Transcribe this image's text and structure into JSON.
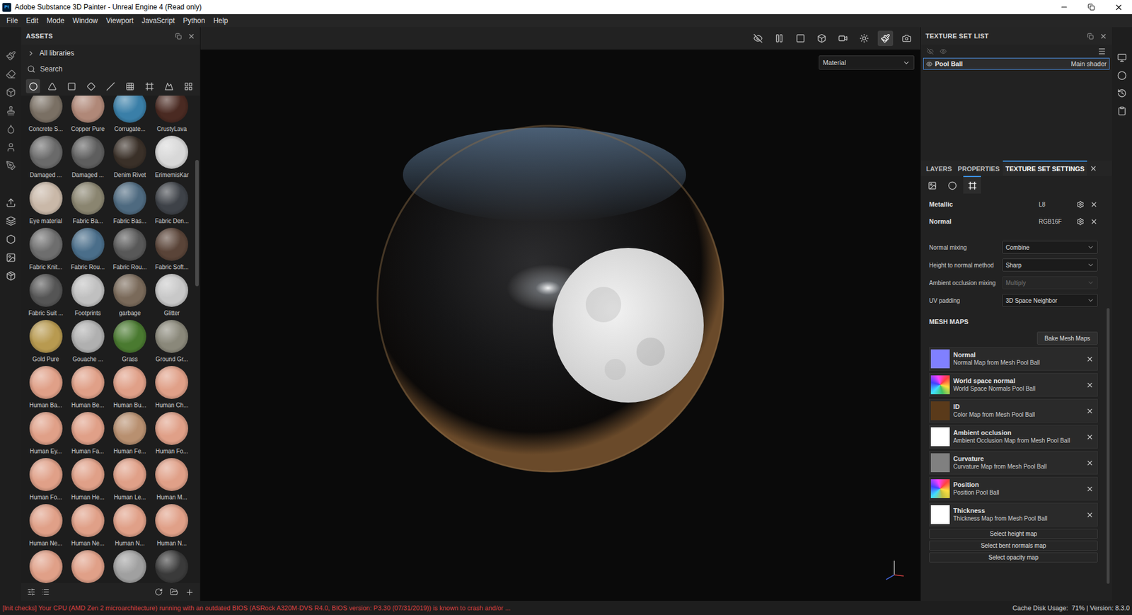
{
  "window": {
    "title": "Adobe Substance 3D Painter - Unreal Engine 4 (Read only)",
    "app_icon": "Pt"
  },
  "menu": [
    "File",
    "Edit",
    "Mode",
    "Window",
    "Viewport",
    "JavaScript",
    "Python",
    "Help"
  ],
  "assets": {
    "title": "ASSETS",
    "library": "All libraries",
    "search": {
      "placeholder": "Search"
    },
    "filters": [
      {
        "selected": true
      },
      {
        "selected": false
      },
      {
        "selected": false
      },
      {
        "selected": false
      },
      {
        "selected": false
      },
      {
        "selected": false
      },
      {
        "selected": false
      },
      {
        "selected": false
      },
      {
        "selected": false
      }
    ],
    "scrollbar": {
      "start": 0.13,
      "size": 0.26
    },
    "items": [
      {
        "label": "Concrete S...",
        "color": "#7a7064"
      },
      {
        "label": "Copper Pure",
        "color": "#b08878"
      },
      {
        "label": "Corrugate...",
        "color": "#3a7fa8"
      },
      {
        "label": "CrustyLava",
        "color": "#4a2a22"
      },
      {
        "label": "Damaged ...",
        "color": "#6a6a6a"
      },
      {
        "label": "Damaged ...",
        "color": "#5e5e5e"
      },
      {
        "label": "Denim Rivet",
        "color": "#3a3028"
      },
      {
        "label": "ErimemisKar",
        "color": "#d8d8d8"
      },
      {
        "label": "Eye material",
        "color": "#c9b8a8"
      },
      {
        "label": "Fabric Ba...",
        "color": "#8a8570"
      },
      {
        "label": "Fabric Bas...",
        "color": "#4e6a80"
      },
      {
        "label": "Fabric Den...",
        "color": "#3e4248"
      },
      {
        "label": "Fabric Knit...",
        "color": "#6e6e6e"
      },
      {
        "label": "Fabric Rou...",
        "color": "#4a6e8a"
      },
      {
        "label": "Fabric Rou...",
        "color": "#585858"
      },
      {
        "label": "Fabric Soft...",
        "color": "#5a4438"
      },
      {
        "label": "Fabric Suit ...",
        "color": "#555555"
      },
      {
        "label": "Footprints",
        "color": "#c0c0c0"
      },
      {
        "label": "garbage",
        "color": "#7a6a5a"
      },
      {
        "label": "Glitter",
        "color": "#c8c8c8"
      },
      {
        "label": "Gold Pure",
        "color": "#b89a50"
      },
      {
        "label": "Gouache ...",
        "color": "#b0b0b0"
      },
      {
        "label": "Grass",
        "color": "#4a7a30"
      },
      {
        "label": "Ground Gr...",
        "color": "#8a887a"
      },
      {
        "label": "Human Ba...",
        "color": "#e0a088"
      },
      {
        "label": "Human Be...",
        "color": "#e0a088"
      },
      {
        "label": "Human Bu...",
        "color": "#e0a088"
      },
      {
        "label": "Human Ch...",
        "color": "#e0a088"
      },
      {
        "label": "Human Ey...",
        "color": "#e0a088"
      },
      {
        "label": "Human Fa...",
        "color": "#e0a088"
      },
      {
        "label": "Human Fe...",
        "color": "#b89070"
      },
      {
        "label": "Human Fo...",
        "color": "#e0a088"
      },
      {
        "label": "Human Fo...",
        "color": "#e0a088"
      },
      {
        "label": "Human He...",
        "color": "#e0a088"
      },
      {
        "label": "Human Le...",
        "color": "#e0a088"
      },
      {
        "label": "Human M...",
        "color": "#e0a088"
      },
      {
        "label": "Human Ne...",
        "color": "#e0a088"
      },
      {
        "label": "Human Ne...",
        "color": "#e0a088"
      },
      {
        "label": "Human N...",
        "color": "#e0a088"
      },
      {
        "label": "Human N...",
        "color": "#e0a088"
      },
      {
        "color": "#e0a088"
      },
      {
        "color": "#e0a088"
      },
      {
        "color": "#a0a0a0"
      },
      {
        "color": "#3a3a3a"
      }
    ]
  },
  "viewport": {
    "mode": "Material",
    "tools": [
      {
        "selected": false
      },
      {
        "selected": false
      },
      {
        "selected": false
      },
      {
        "selected": false
      },
      {
        "selected": false
      },
      {
        "selected": false
      },
      {
        "selected": true
      },
      {
        "selected": false
      }
    ]
  },
  "texture_set_list": {
    "title": "TEXTURE SET LIST",
    "items": [
      {
        "name": "Pool Ball",
        "shader": "Main shader",
        "selected": true,
        "visible": true
      }
    ]
  },
  "tabs": [
    {
      "label": "LAYERS",
      "selected": false
    },
    {
      "label": "PROPERTIES",
      "selected": false
    },
    {
      "label": "TEXTURE SET SETTINGS",
      "selected": true
    }
  ],
  "settings_tabs": [
    {
      "selected": false
    },
    {
      "selected": false
    },
    {
      "selected": true
    }
  ],
  "channels": [
    {
      "name": "Metallic",
      "format": "L8"
    },
    {
      "name": "Normal",
      "format": "RGB16F"
    }
  ],
  "options": [
    {
      "label": "Normal mixing",
      "value": "Combine",
      "disabled": false
    },
    {
      "label": "Height to normal method",
      "value": "Sharp",
      "disabled": false
    },
    {
      "label": "Ambient occlusion mixing",
      "value": "Multiply",
      "disabled": true
    },
    {
      "label": "UV padding",
      "value": "3D Space Neighbor",
      "disabled": false
    }
  ],
  "mesh_maps": {
    "title": "MESH MAPS",
    "bake_button": "Bake Mesh Maps",
    "maps": [
      {
        "name": "Normal",
        "source": "Normal Map from Mesh Pool Ball",
        "kind": "solid",
        "color": "#8080ff"
      },
      {
        "name": "World space normal",
        "source": "World Space Normals Pool Ball",
        "kind": "gradient",
        "color": "#40c060"
      },
      {
        "name": "ID",
        "source": "Color Map from Mesh Pool Ball",
        "kind": "solid",
        "color": "#5a3a1a"
      },
      {
        "name": "Ambient occlusion",
        "source": "Ambient Occlusion Map from Mesh Pool Ball",
        "kind": "solid",
        "color": "#ffffff"
      },
      {
        "name": "Curvature",
        "source": "Curvature Map from Mesh Pool Ball",
        "kind": "solid",
        "color": "#808080"
      },
      {
        "name": "Position",
        "source": "Position Pool Ball",
        "kind": "gradient",
        "color": "#c0c040"
      },
      {
        "name": "Thickness",
        "source": "Thickness Map from Mesh Pool Ball",
        "kind": "solid",
        "color": "#ffffff"
      }
    ],
    "buttons": [
      "Select height map",
      "Select bent normals map",
      "Select opacity map"
    ]
  },
  "right_scrollbar": {
    "start": 0.28,
    "size": 0.68
  },
  "status_bar": {
    "message": "[Init checks] Your CPU (AMD Zen 2 microarchitecture) running with an outdated BIOS (ASRock A320M-DVS R4.0, BIOS version: P3.30 (07/31/2019)) is known to crash and/or ...",
    "info": "Cache Disk Usage:  71% | Version: 8.3.0"
  }
}
